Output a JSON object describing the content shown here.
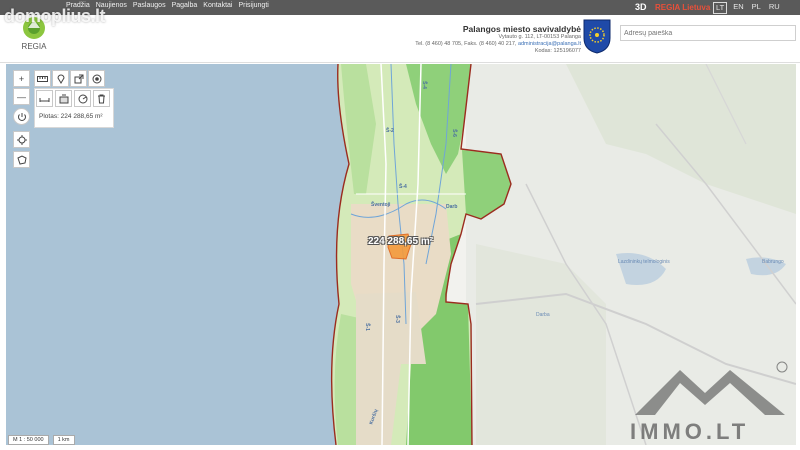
{
  "topbar": {
    "nav": [
      "Pradžia",
      "Naujienos",
      "Paslaugos",
      "Pagalba",
      "Kontaktai",
      "Prisijungti"
    ],
    "brand_3d": "3D",
    "brand_name": "REGIA Lietuva",
    "languages": [
      "LT",
      "EN",
      "PL",
      "RU"
    ],
    "active_language": "LT"
  },
  "header": {
    "logo_text": "REGIA",
    "municipality_name": "Palangos miesto savivaldybė",
    "address": "Vytauto g. 112, LT-00153 Palanga",
    "contacts_prefix": "Tel. (8 460) 48 705, Faks. (8 460) 40 217,",
    "email": "administracija@palanga.lt",
    "code": "Kodas: 125196077"
  },
  "search": {
    "placeholder": "Adresų paieška"
  },
  "toolbar": {
    "zoom_in": "+",
    "zoom_out": "—"
  },
  "measurement": {
    "panel_label": "Plotas: 224 288,65 m²",
    "overlay_label": "224 288,65 m²"
  },
  "map": {
    "place_labels": [
      {
        "text": "Šventoji"
      },
      {
        "text": "Š-4"
      },
      {
        "text": "Š-2"
      },
      {
        "text": "Š-4"
      },
      {
        "text": "Š-6"
      },
      {
        "text": "Darb"
      },
      {
        "text": "Š-1"
      },
      {
        "text": "Š-3"
      },
      {
        "text": "Kuršių"
      }
    ],
    "grey_labels": [
      {
        "text": "Lazdininkų telmologinis"
      },
      {
        "text": "Darba"
      },
      {
        "text": "Babrungo"
      }
    ]
  },
  "scale": {
    "ratio": "M 1 : 50 000",
    "bar": "1 km"
  },
  "watermarks": {
    "top": "domoplius.lt",
    "bottom": "IMMO.LT"
  },
  "colors": {
    "sea": "#a8c0d4",
    "land": "#cfe8b4",
    "forest": "#7ec96c",
    "boundary": "#9b2c1f",
    "area_fill": "#f39a3c"
  }
}
